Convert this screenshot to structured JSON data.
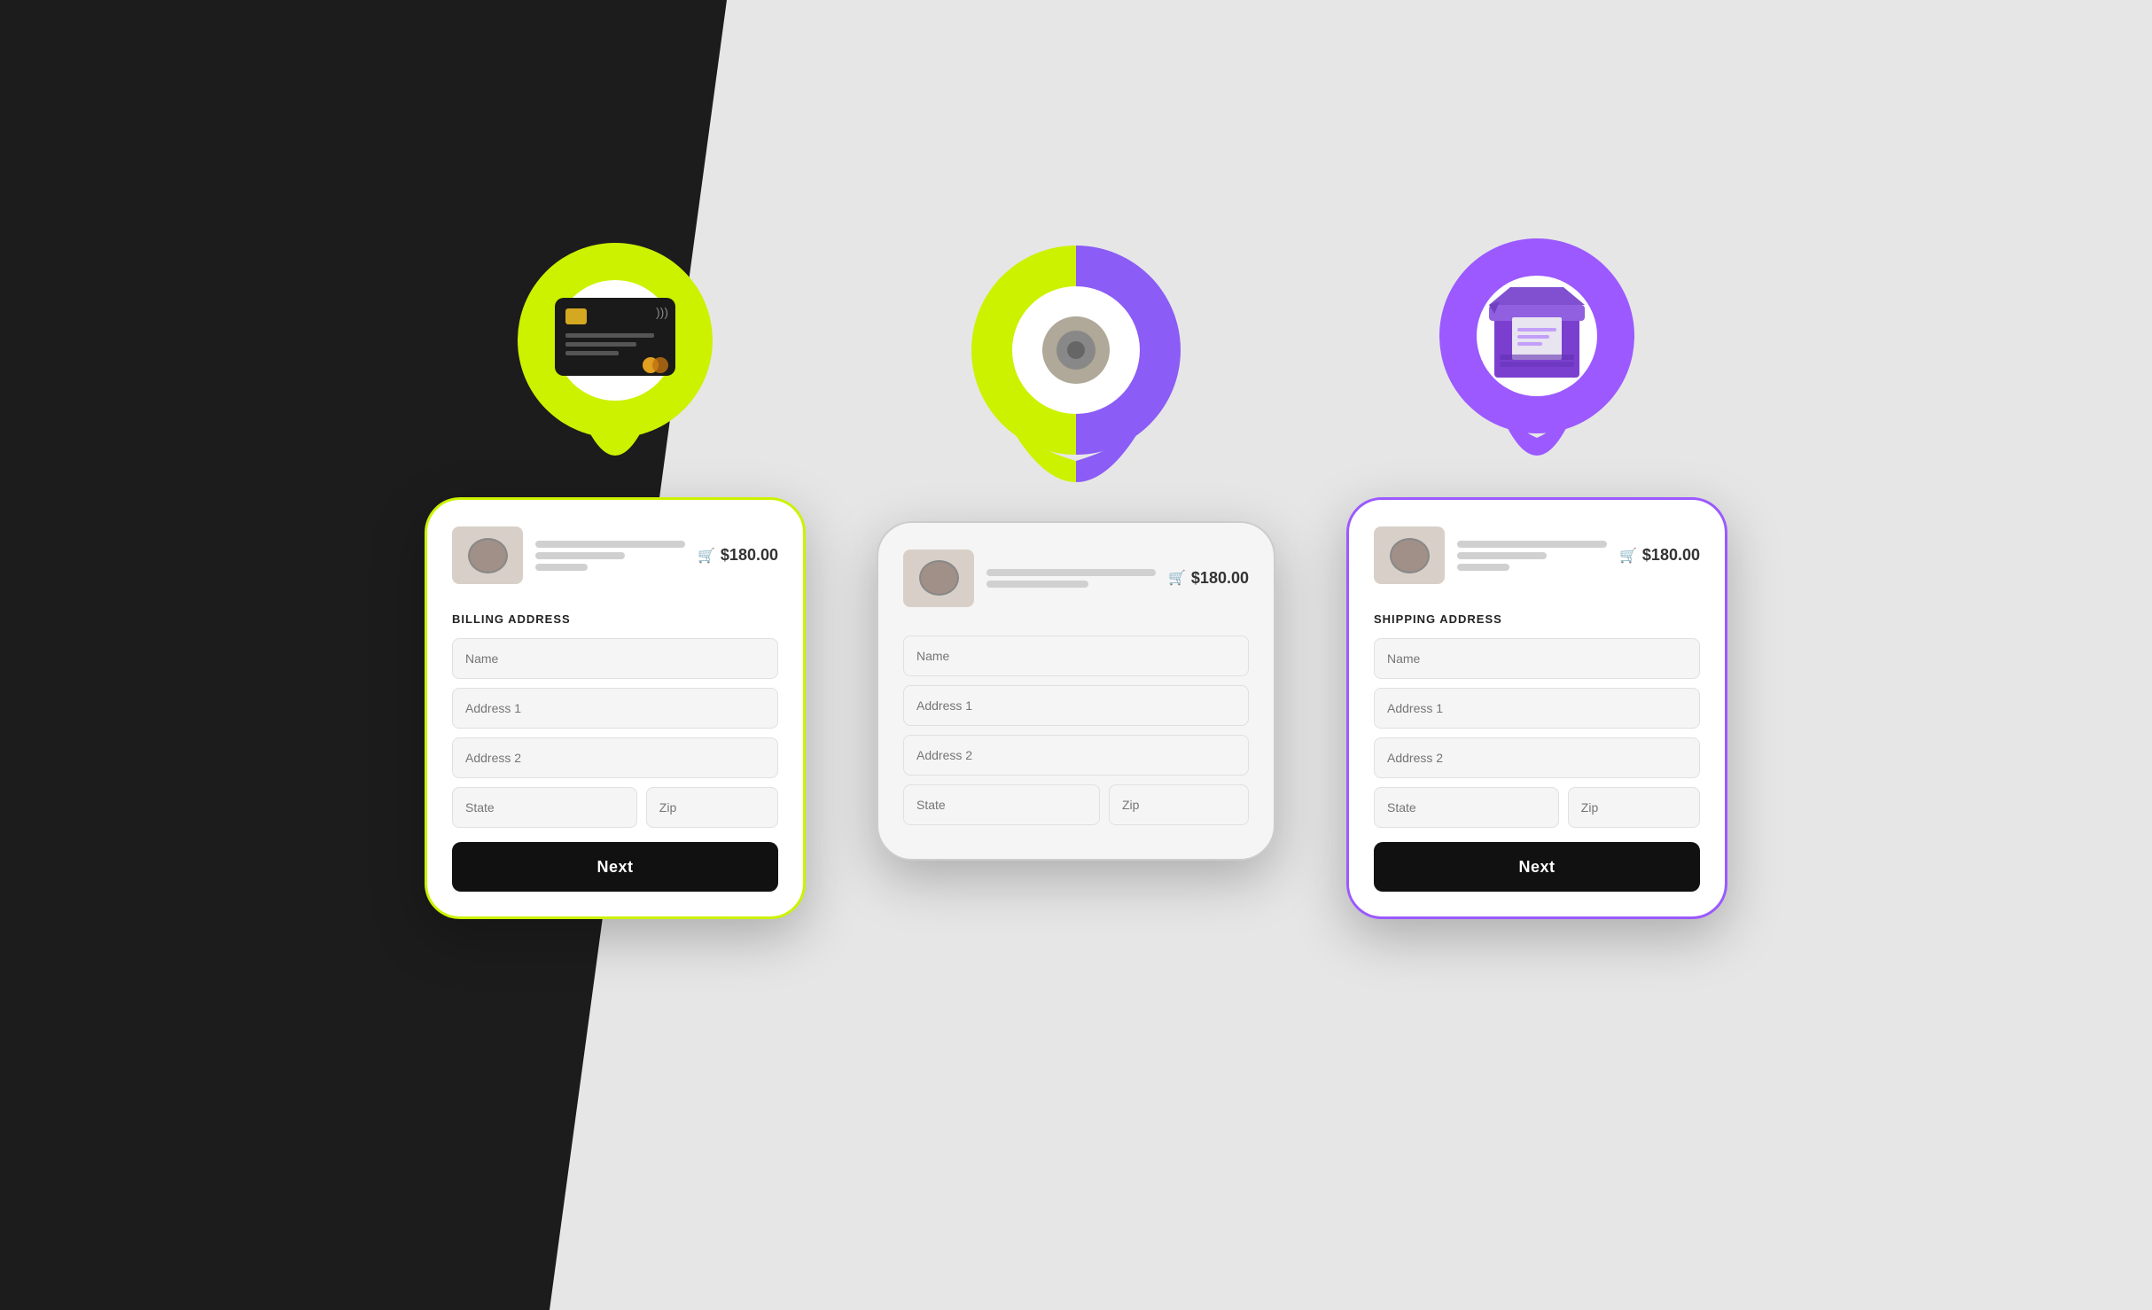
{
  "page": {
    "bg_dark_color": "#1c1c1c",
    "bg_light_color": "#e8e8e8"
  },
  "cards": [
    {
      "id": "billing",
      "type": "dark-card",
      "pin_color_left": "#ccf200",
      "pin_color_right": "#ccf200",
      "label": "BILLING ADDRESS",
      "price": "$180.00",
      "fields": {
        "name": "Name",
        "address1": "Address 1",
        "address2": "Address 2",
        "state": "State",
        "zip": "Zip"
      },
      "button_label": "Next"
    },
    {
      "id": "location",
      "type": "middle-card",
      "pin_color_left": "#ccf200",
      "pin_color_right": "#8b5cf6",
      "label": "",
      "price": "$180.00",
      "fields": {
        "name": "Name",
        "address1": "Address 1",
        "address2": "Address 2",
        "state": "State",
        "zip": "Zip"
      },
      "button_label": ""
    },
    {
      "id": "shipping",
      "type": "purple-card",
      "pin_color_left": "#9b59ff",
      "pin_color_right": "#9b59ff",
      "label": "SHIPPING ADDRESS",
      "price": "$180.00",
      "fields": {
        "name": "Name",
        "address1": "Address 1",
        "address2": "Address 2",
        "state": "State",
        "zip": "Zip"
      },
      "button_label": "Next"
    }
  ]
}
